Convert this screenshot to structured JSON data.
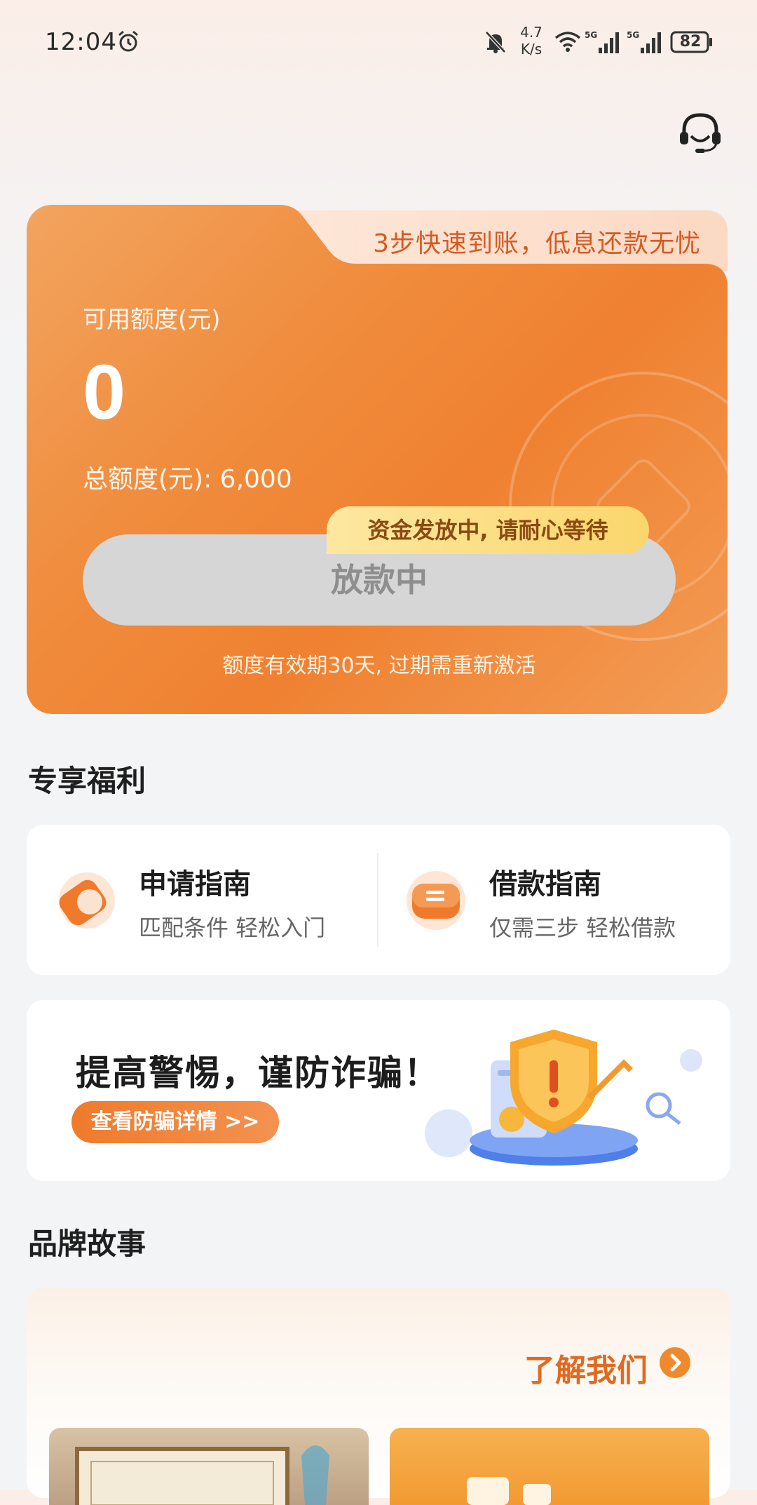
{
  "status_bar": {
    "time": "12:04",
    "net_speed_value": "4.7",
    "net_speed_unit": "K/s",
    "battery": "82",
    "icons": [
      "alarm-icon",
      "bell-off-icon",
      "wifi-icon",
      "signal-5g-icon",
      "signal-5g-icon",
      "battery-icon"
    ]
  },
  "header": {
    "support_icon": "headset-icon"
  },
  "credit_card": {
    "tab_text": "3步快速到账，低息还款无忧",
    "available_label": "可用额度(元)",
    "available_value": "0",
    "total_line": "总额度(元): 6,000",
    "tooltip": "资金发放中, 请耐心等待",
    "button_label": "放款中",
    "validity_note": "额度有效期30天, 过期需重新激活",
    "accent_color": "#ef8131"
  },
  "benefits": {
    "section_title": "专享福利",
    "items": [
      {
        "title": "申请指南",
        "subtitle": "匹配条件 轻松入门",
        "icon": "compass-icon"
      },
      {
        "title": "借款指南",
        "subtitle": "仅需三步 轻松借款",
        "icon": "ticket-icon"
      }
    ]
  },
  "fraud_banner": {
    "title": "提高警惕，谨防诈骗！",
    "button_label": "查看防骗详情 >>",
    "illustration": "shield-warning-illustration"
  },
  "brand": {
    "section_title": "品牌故事",
    "learn_more": "了解我们",
    "learn_more_icon": "chevron-right-circle-icon"
  }
}
